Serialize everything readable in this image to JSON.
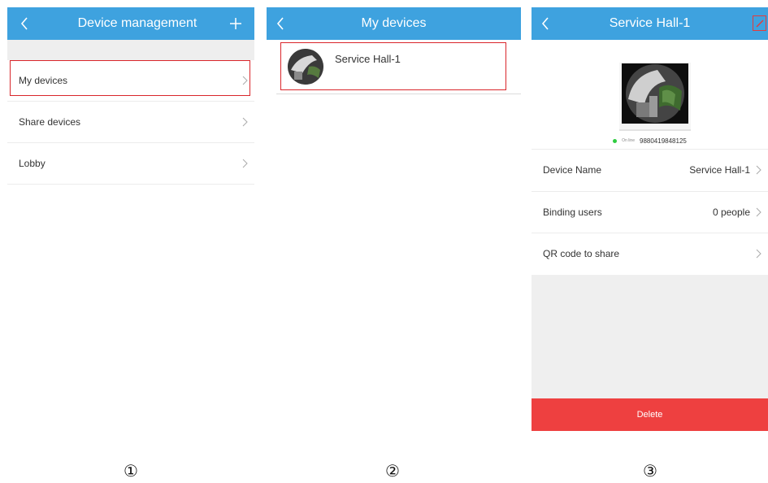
{
  "screen1": {
    "title": "Device management",
    "items": [
      {
        "label": "My devices"
      },
      {
        "label": "Share devices"
      },
      {
        "label": "Lobby"
      }
    ]
  },
  "screen2": {
    "title": "My devices",
    "device": {
      "name": "Service Hall-1"
    }
  },
  "screen3": {
    "title": "Service Hall-1",
    "status": "On line",
    "device_id": "9880419848125",
    "rows": [
      {
        "label": "Device Name",
        "value": "Service Hall-1"
      },
      {
        "label": "Binding users",
        "value": "0 people"
      },
      {
        "label": "QR code to share",
        "value": ""
      }
    ],
    "delete_label": "Delete"
  },
  "step_numbers": [
    "①",
    "②",
    "③"
  ],
  "colors": {
    "header_blue": "#3ea2df",
    "highlight_red": "#d9262b",
    "delete_red": "#ee4040",
    "online_green": "#2ecc40"
  },
  "icons": {
    "back": "back-icon",
    "add": "plus-icon",
    "chevron": "chevron-right-icon",
    "edit": "edit-icon"
  }
}
